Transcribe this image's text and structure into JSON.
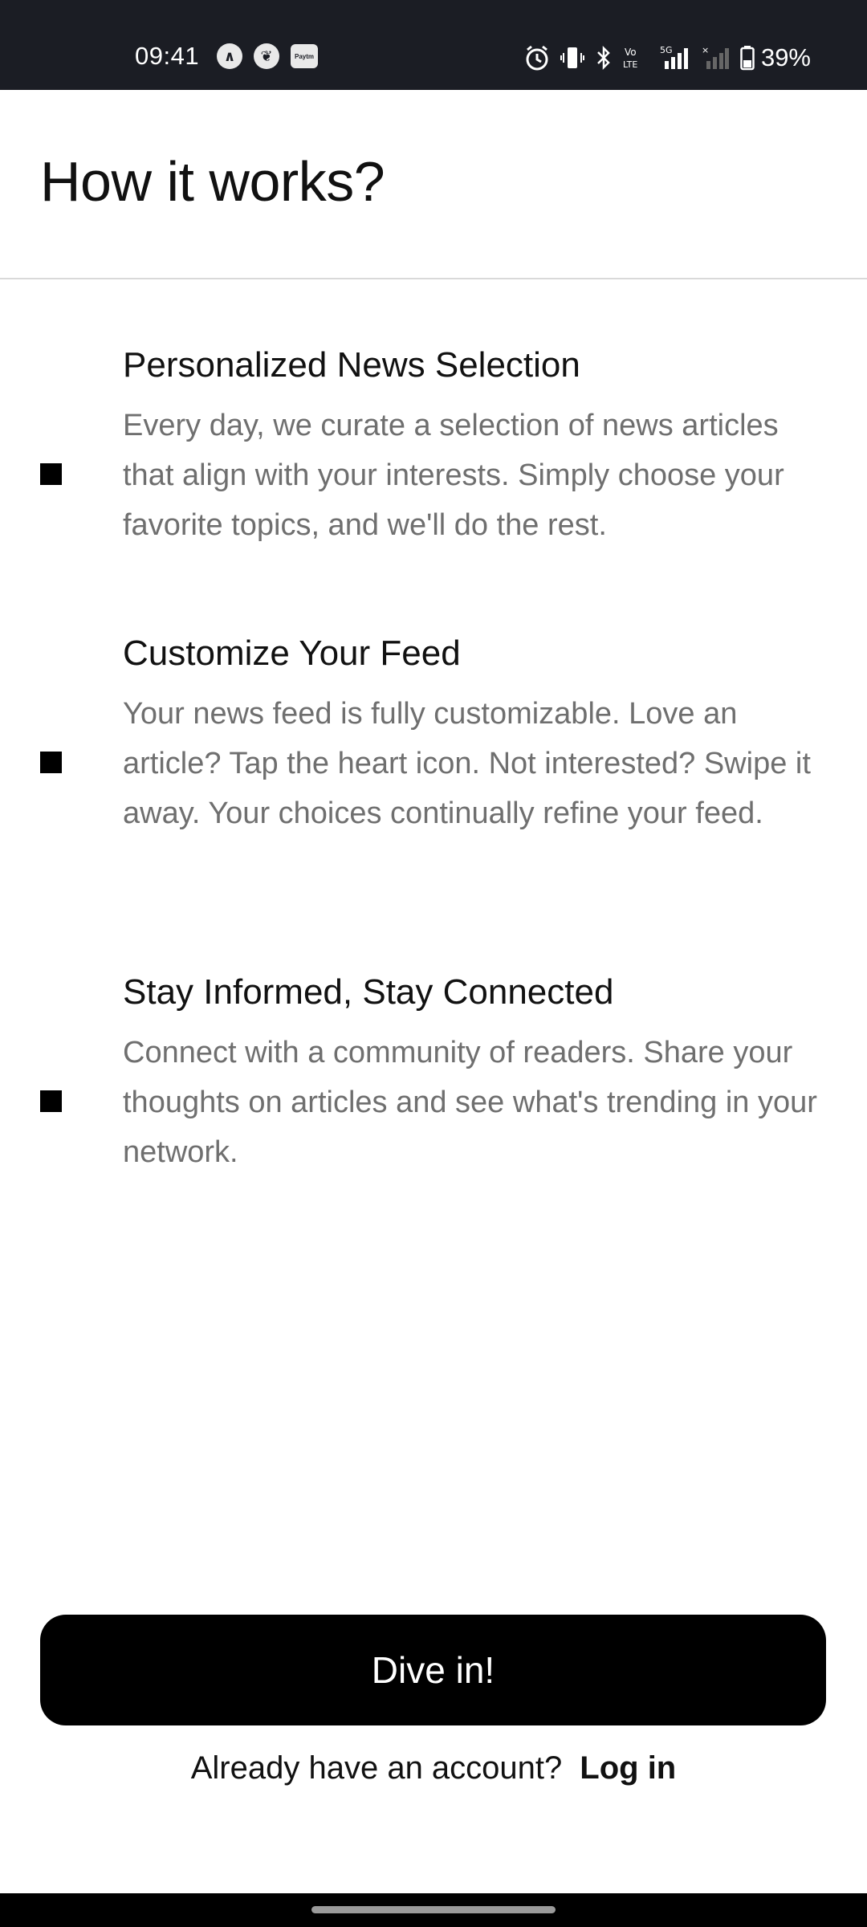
{
  "status_bar": {
    "time": "09:41",
    "left_icons": [
      {
        "name": "app-notification-icon",
        "glyph": "∧"
      },
      {
        "name": "leaf-notification-icon",
        "glyph": "❦"
      },
      {
        "name": "paytm-notification-icon",
        "glyph": "Paytm"
      }
    ],
    "network_label": "5G",
    "volte_label": "Vo LTE",
    "battery_percent": "39%"
  },
  "header": {
    "title": "How it works?"
  },
  "features": [
    {
      "title": "Personalized News Selection",
      "body": "Every day, we curate a selection of news articles that align with your interests. Simply choose your favorite topics, and we'll do the rest."
    },
    {
      "title": "Customize Your Feed",
      "body": "Your news feed is fully customizable. Love an article? Tap the heart icon. Not interested? Swipe it away. Your choices continually refine your feed."
    },
    {
      "title": "Stay Informed, Stay Connected",
      "body": "Connect with a community of readers. Share your thoughts on articles and see what's trending in your network."
    }
  ],
  "cta": {
    "label": "Dive in!"
  },
  "login": {
    "prompt": "Already have an account?",
    "link_label": "Log in"
  },
  "colors": {
    "status_bar_bg": "#1b1d24",
    "button_bg": "#000000",
    "body_text": "#6f6f6f",
    "title_text": "#111111"
  }
}
